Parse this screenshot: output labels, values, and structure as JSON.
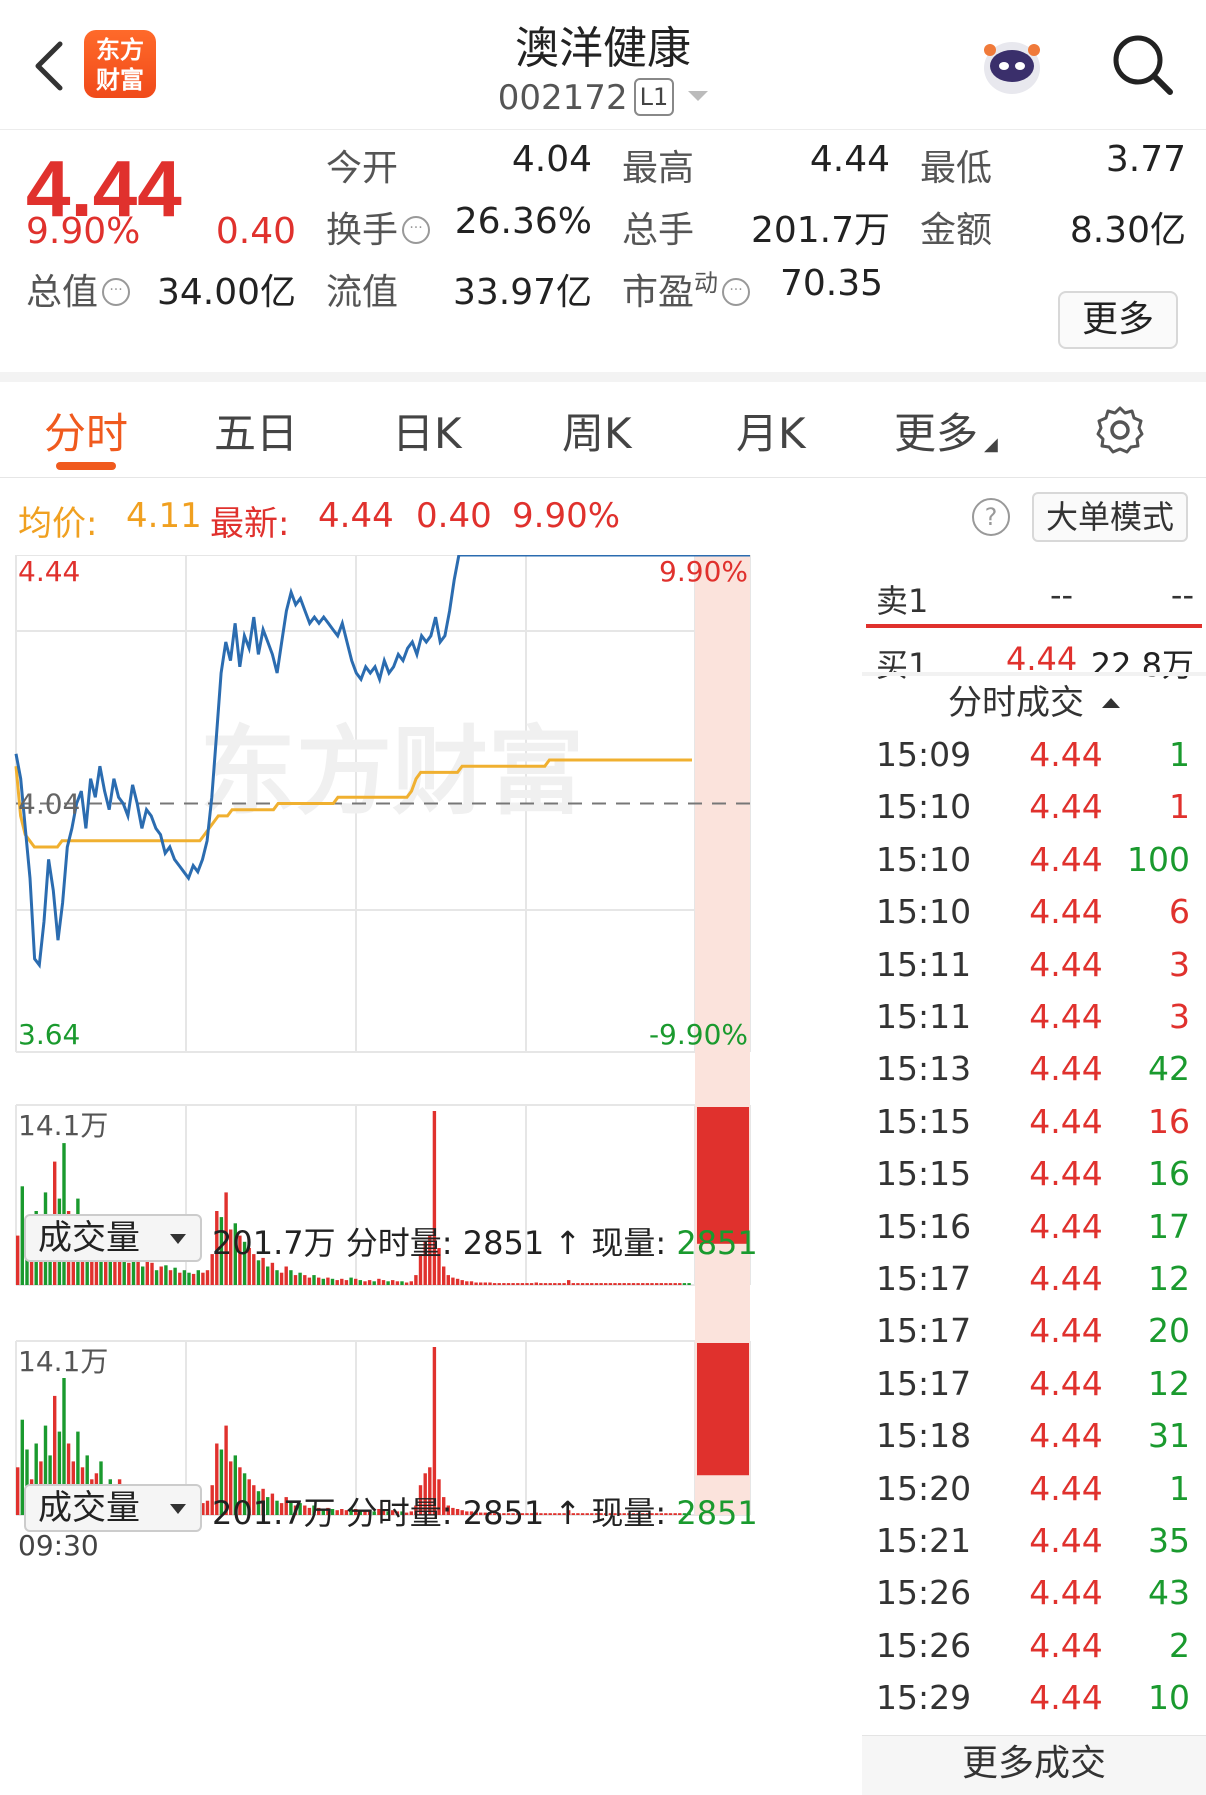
{
  "header": {
    "logo_line1": "东方",
    "logo_line2": "财富",
    "title": "澳洋健康",
    "code": "002172",
    "level_badge": "L1"
  },
  "quote": {
    "price": "4.44",
    "change_pct": "9.90%",
    "change": "0.40",
    "fields": [
      {
        "label": "今开",
        "value": "4.04",
        "color": "default"
      },
      {
        "label": "最高",
        "value": "4.44",
        "color": "red"
      },
      {
        "label": "最低",
        "value": "3.77",
        "color": "green"
      },
      {
        "label": "换手",
        "value": "26.36%",
        "color": "default"
      },
      {
        "label": "总手",
        "value": "201.7万",
        "color": "default"
      },
      {
        "label": "金额",
        "value": "8.30亿",
        "color": "default"
      },
      {
        "label": "总值",
        "value": "34.00亿",
        "color": "default"
      },
      {
        "label": "流值",
        "value": "33.97亿",
        "color": "default"
      },
      {
        "label": "市盈",
        "superscript": "动",
        "value": "70.35",
        "color": "default"
      }
    ],
    "more_label": "更多"
  },
  "tabs": [
    {
      "label": "分时",
      "active": true
    },
    {
      "label": "五日",
      "active": false
    },
    {
      "label": "日K",
      "active": false
    },
    {
      "label": "周K",
      "active": false
    },
    {
      "label": "月K",
      "active": false
    },
    {
      "label": "更多",
      "active": false
    }
  ],
  "info": {
    "avg_label": "均价:",
    "avg_value": "4.11",
    "latest_label": "最新:",
    "latest_value": "4.44",
    "latest_change": "0.40",
    "latest_pct": "9.90%",
    "help_glyph": "?",
    "big_order_label": "大单模式"
  },
  "chart_data": {
    "type": "line",
    "ylim": [
      3.64,
      4.44
    ],
    "prev_close": 4.04,
    "y_top_label": "4.44",
    "y_mid_label": "4.04",
    "y_bottom_label": "3.64",
    "pct_top_label": "9.90%",
    "pct_bottom_label": "-9.90%",
    "x_start_label": "09:30",
    "series": [
      {
        "values": [
          4.12,
          4.08,
          4.0,
          3.92,
          3.79,
          3.78,
          3.85,
          3.95,
          3.9,
          3.82,
          3.88,
          3.97,
          4.0,
          4.04,
          4.06,
          4.0,
          4.08,
          4.05,
          4.1,
          4.06,
          4.03,
          4.08,
          4.05,
          4.04,
          4.02,
          4.07,
          4.04,
          4.0,
          4.03,
          4.02,
          4.0,
          3.99,
          3.96,
          3.97,
          3.95,
          3.94,
          3.93,
          3.92,
          3.94,
          3.93,
          3.95,
          3.98,
          4.05,
          4.15,
          4.25,
          4.3,
          4.27,
          4.33,
          4.26,
          4.31,
          4.29,
          4.34,
          4.28,
          4.32,
          4.3,
          4.28,
          4.25,
          4.3,
          4.35,
          4.38,
          4.36,
          4.37,
          4.35,
          4.33,
          4.34,
          4.33,
          4.34,
          4.33,
          4.32,
          4.31,
          4.33,
          4.3,
          4.27,
          4.25,
          4.24,
          4.26,
          4.25,
          4.26,
          4.24,
          4.27,
          4.25,
          4.26,
          4.28,
          4.27,
          4.29,
          4.3,
          4.28,
          4.31,
          4.3,
          4.31,
          4.34,
          4.3,
          4.31,
          4.35,
          4.4,
          4.44,
          4.44,
          4.44,
          4.44,
          4.44,
          4.44,
          4.44,
          4.44,
          4.44,
          4.44,
          4.44,
          4.44,
          4.44,
          4.44,
          4.44,
          4.44,
          4.44,
          4.44,
          4.44,
          4.44,
          4.44,
          4.44,
          4.44,
          4.44,
          4.44,
          4.44,
          4.44,
          4.44,
          4.44,
          4.44,
          4.44,
          4.44,
          4.44,
          4.44,
          4.44,
          4.44,
          4.44,
          4.44,
          4.44,
          4.44,
          4.44,
          4.44,
          4.44,
          4.44,
          4.44,
          4.44,
          4.44,
          4.44,
          4.44,
          4.44,
          4.44
        ]
      },
      {
        "values": [
          4.1,
          4.02,
          3.99,
          3.98,
          3.97,
          3.97,
          3.97,
          3.97,
          3.97,
          3.97,
          3.98,
          3.98,
          3.98,
          3.98,
          3.98,
          3.98,
          3.98,
          3.98,
          3.98,
          3.98,
          3.98,
          3.98,
          3.98,
          3.98,
          3.98,
          3.98,
          3.98,
          3.98,
          3.98,
          3.98,
          3.98,
          3.98,
          3.98,
          3.98,
          3.98,
          3.98,
          3.98,
          3.98,
          3.98,
          3.98,
          3.98,
          3.99,
          4.0,
          4.01,
          4.02,
          4.02,
          4.02,
          4.03,
          4.03,
          4.03,
          4.03,
          4.03,
          4.03,
          4.03,
          4.03,
          4.03,
          4.03,
          4.04,
          4.04,
          4.04,
          4.04,
          4.04,
          4.04,
          4.04,
          4.04,
          4.04,
          4.04,
          4.04,
          4.04,
          4.04,
          4.05,
          4.05,
          4.05,
          4.05,
          4.05,
          4.05,
          4.05,
          4.05,
          4.05,
          4.05,
          4.05,
          4.05,
          4.05,
          4.05,
          4.05,
          4.05,
          4.06,
          4.08,
          4.09,
          4.09,
          4.09,
          4.09,
          4.09,
          4.09,
          4.09,
          4.09,
          4.09,
          4.1,
          4.1,
          4.1,
          4.1,
          4.1,
          4.1,
          4.1,
          4.1,
          4.1,
          4.1,
          4.1,
          4.1,
          4.1,
          4.1,
          4.1,
          4.1,
          4.1,
          4.1,
          4.1,
          4.11,
          4.11,
          4.11,
          4.11,
          4.11,
          4.11,
          4.11,
          4.11,
          4.11,
          4.11,
          4.11,
          4.11,
          4.11,
          4.11,
          4.11,
          4.11,
          4.11,
          4.11,
          4.11,
          4.11,
          4.11,
          4.11,
          4.11,
          4.11,
          4.11,
          4.11,
          4.11,
          4.11,
          4.11,
          4.11,
          4.11,
          4.11
        ]
      }
    ]
  },
  "volume": {
    "selector_label": "成交量",
    "total": "201.7万",
    "minute_label": "分时量:",
    "minute_value": "2851",
    "arrow_glyph": "↑",
    "now_label": "现量:",
    "now_value": "2851",
    "max_label": "14.1万"
  },
  "volume_data": {
    "max": 141000,
    "values": [
      40000,
      80000,
      55000,
      30000,
      60000,
      45000,
      75000,
      50000,
      100000,
      70000,
      115000,
      60000,
      45000,
      70000,
      40000,
      50000,
      30000,
      35000,
      45000,
      25000,
      30000,
      20000,
      30000,
      22000,
      18000,
      25000,
      20000,
      15000,
      20000,
      18000,
      12000,
      15000,
      16000,
      12000,
      14000,
      10000,
      12000,
      10000,
      9000,
      12000,
      10000,
      12000,
      25000,
      60000,
      55000,
      75000,
      45000,
      50000,
      40000,
      35000,
      30000,
      25000,
      20000,
      22000,
      15000,
      18000,
      12000,
      10000,
      15000,
      12000,
      8000,
      10000,
      8000,
      6000,
      8000,
      6000,
      5000,
      6000,
      5000,
      4000,
      5000,
      4000,
      6000,
      5000,
      4000,
      3000,
      4000,
      3000,
      5000,
      4000,
      3000,
      4000,
      3000,
      3000,
      2000,
      3000,
      8000,
      25000,
      35000,
      40000,
      141000,
      30000,
      15000,
      8000,
      6000,
      5000,
      4000,
      3000,
      3000,
      2000,
      2000,
      2000,
      2000,
      1500,
      1500,
      1500,
      1500,
      1500,
      1500,
      1500,
      1500,
      1500,
      2000,
      1500,
      1500,
      1500,
      1500,
      1500,
      1500,
      4000,
      1500,
      1500,
      1500,
      1500,
      1500,
      1500,
      1500,
      1500,
      1500,
      1500,
      1500,
      1500,
      1500,
      1500,
      1500,
      1500,
      1500,
      1500,
      1500,
      1500,
      1500,
      1500,
      1500,
      1500,
      1500,
      1500
    ],
    "up": [
      1,
      0,
      0,
      1,
      0,
      1,
      0,
      0,
      1,
      0,
      0,
      1,
      1,
      0,
      1,
      0,
      1,
      1,
      0,
      1,
      0,
      1,
      1,
      0,
      1,
      0,
      1,
      0,
      1,
      1,
      0,
      1,
      0,
      1,
      0,
      1,
      0,
      0,
      1,
      0,
      1,
      1,
      1,
      1,
      0,
      1,
      1,
      0,
      1,
      0,
      1,
      1,
      0,
      1,
      0,
      1,
      0,
      1,
      1,
      0,
      1,
      0,
      1,
      1,
      0,
      1,
      0,
      1,
      0,
      1,
      1,
      1,
      0,
      1,
      0,
      1,
      1,
      0,
      1,
      1,
      0,
      1,
      1,
      0,
      1,
      1,
      1,
      1,
      1,
      1,
      1,
      1,
      1,
      1,
      1,
      1,
      1,
      1,
      1,
      1,
      1,
      1,
      1,
      1,
      1,
      1,
      1,
      1,
      1,
      1,
      1,
      1,
      1,
      1,
      1,
      1,
      1,
      1,
      1,
      1,
      1,
      1,
      1,
      1,
      1,
      1,
      1,
      1,
      1,
      1,
      1,
      1,
      1,
      1,
      1,
      1,
      1,
      1,
      1,
      1,
      1,
      1,
      1,
      1
    ]
  },
  "watermark": "东方财富",
  "order_book": {
    "sell1_label": "卖1",
    "sell1_price": "--",
    "sell1_volume": "--",
    "buy1_label": "买1",
    "buy1_price": "4.44",
    "buy1_volume": "22.8万"
  },
  "trades": {
    "title": "分时成交",
    "rows": [
      {
        "time": "15:09",
        "price": "4.44",
        "volume": "1",
        "side": "green"
      },
      {
        "time": "15:10",
        "price": "4.44",
        "volume": "1",
        "side": "red"
      },
      {
        "time": "15:10",
        "price": "4.44",
        "volume": "100",
        "side": "green"
      },
      {
        "time": "15:10",
        "price": "4.44",
        "volume": "6",
        "side": "red"
      },
      {
        "time": "15:11",
        "price": "4.44",
        "volume": "3",
        "side": "red"
      },
      {
        "time": "15:11",
        "price": "4.44",
        "volume": "3",
        "side": "red"
      },
      {
        "time": "15:13",
        "price": "4.44",
        "volume": "42",
        "side": "green"
      },
      {
        "time": "15:15",
        "price": "4.44",
        "volume": "16",
        "side": "red"
      },
      {
        "time": "15:15",
        "price": "4.44",
        "volume": "16",
        "side": "green"
      },
      {
        "time": "15:16",
        "price": "4.44",
        "volume": "17",
        "side": "green"
      },
      {
        "time": "15:17",
        "price": "4.44",
        "volume": "12",
        "side": "green"
      },
      {
        "time": "15:17",
        "price": "4.44",
        "volume": "20",
        "side": "green"
      },
      {
        "time": "15:17",
        "price": "4.44",
        "volume": "12",
        "side": "green"
      },
      {
        "time": "15:18",
        "price": "4.44",
        "volume": "31",
        "side": "green"
      },
      {
        "time": "15:20",
        "price": "4.44",
        "volume": "1",
        "side": "green"
      },
      {
        "time": "15:21",
        "price": "4.44",
        "volume": "35",
        "side": "green"
      },
      {
        "time": "15:26",
        "price": "4.44",
        "volume": "43",
        "side": "green"
      },
      {
        "time": "15:26",
        "price": "4.44",
        "volume": "2",
        "side": "green"
      },
      {
        "time": "15:29",
        "price": "4.44",
        "volume": "10",
        "side": "green"
      }
    ],
    "more_label": "更多成交"
  },
  "colors": {
    "red": "#e0312d",
    "green": "#1a9a2e",
    "accent": "#f05a1e",
    "price_line": "#2b6cb0",
    "avg_line": "#f0b030"
  }
}
